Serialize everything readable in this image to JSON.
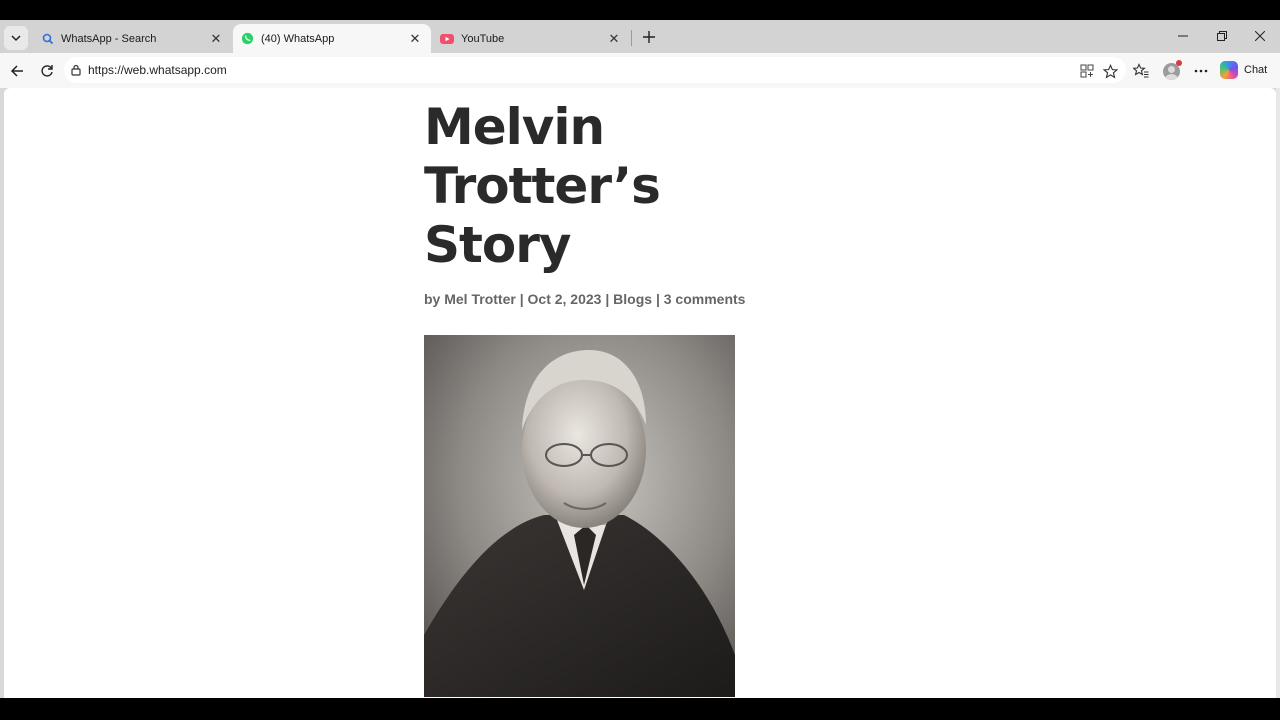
{
  "browser": {
    "tabs": [
      {
        "label": "WhatsApp - Search",
        "icon": "search-icon",
        "active": false
      },
      {
        "label": "(40) WhatsApp",
        "icon": "whatsapp-icon",
        "active": true
      },
      {
        "label": "YouTube",
        "icon": "youtube-icon",
        "active": false
      }
    ],
    "url": "https://web.whatsapp.com",
    "chat_label": "Chat"
  },
  "article": {
    "title_lines": [
      "Melvin",
      "Trotter’s",
      "Story"
    ],
    "by": "by",
    "author": "Mel Trotter",
    "sep1": "|",
    "date": "Oct 2, 2023",
    "sep2": "|",
    "category": "Blogs",
    "sep3": "|",
    "comments": "3 comments"
  },
  "colors": {
    "tab_strip": "#d3d3d3",
    "active_tab": "#f7f7f7",
    "title_text": "#2a2a2a",
    "meta_text": "#666666",
    "whatsapp_green": "#25d366",
    "youtube_red": "#f0506e"
  }
}
